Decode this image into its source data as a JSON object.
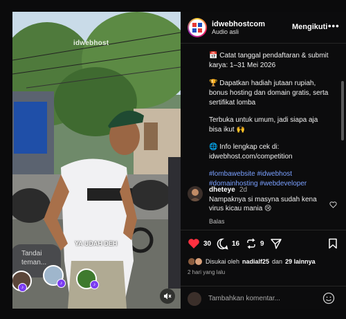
{
  "media": {
    "watermark": "idwebhost",
    "video_caption": "YA UDAH DEH",
    "tag_prompt": "Tandai teman...",
    "mute_icon": "speaker-muted-icon"
  },
  "post": {
    "account_name": "idwebhostcom",
    "account_subtitle": "Audio asli",
    "follow_label": "Mengikuti",
    "more_label": "•••",
    "caption": {
      "line1": "📅 Catat tanggal pendaftaran & submit",
      "line2": "karya: 1–31 Mei 2026",
      "line3": "🏆 Dapatkan hadiah jutaan rupiah,",
      "line4": "bonus hosting dan domain gratis, serta",
      "line5": "sertifikat lomba",
      "line6": "Terbuka untuk umum, jadi siapa aja",
      "line7": "bisa ikut 🙌",
      "line8": "🌐 Info lengkap cek di:",
      "line9": "idwebhost.com/competition",
      "hashtags1": "#lombawebsite #idwebhost",
      "hashtags2": "#domainhosting #webdeveloper"
    },
    "comment": {
      "username": "dheteye",
      "time": "2d",
      "text": "Nampaknya si masyna sudah kena virus kicau mania 😢",
      "reply_label": "Balas"
    },
    "actions": {
      "like_count": "30",
      "comment_count": "16",
      "share_count": "9"
    },
    "liked_by": {
      "prefix": "Disukai oleh",
      "user": "nadialf25",
      "mid": "dan",
      "others": "29 lainnya"
    },
    "time_ago": "2 hari yang lalu",
    "add_comment_placeholder": "Tambahkan komentar..."
  },
  "colors": {
    "like_red": "#ff3040",
    "hashtag_blue": "#7aa0ff",
    "badge_purple": "#7b3cf2"
  }
}
